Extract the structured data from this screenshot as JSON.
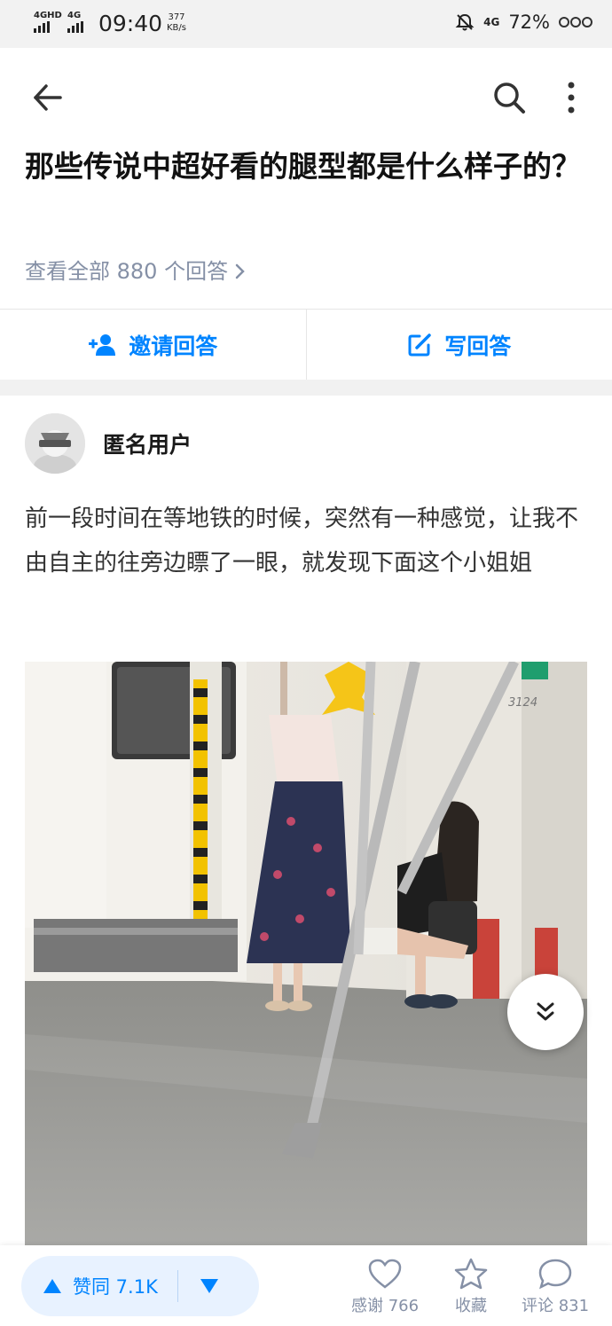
{
  "status": {
    "network1": "4GHD",
    "network2": "4G",
    "time": "09:40",
    "speed_value": "377",
    "speed_unit": "KB/s",
    "signal": "4G",
    "battery": "72%"
  },
  "question": {
    "title": "那些传说中超好看的腿型都是什么样子的？",
    "answers_link": "查看全部 880 个回答"
  },
  "actions": {
    "invite": "邀请回答",
    "write": "写回答"
  },
  "answer": {
    "author": "匿名用户",
    "text": "前一段时间在等地铁的时候，突然有一种感觉，让我不由自主的往旁边瞟了一眼，就发现下面这个小姐姐",
    "photo_label": "3124"
  },
  "bottom": {
    "vote_label": "赞同 7.1K",
    "thanks_label": "感谢 766",
    "collect_label": "收藏",
    "comment_label": "评论 831"
  },
  "colors": {
    "accent": "#0084ff",
    "muted": "#8590a6"
  }
}
